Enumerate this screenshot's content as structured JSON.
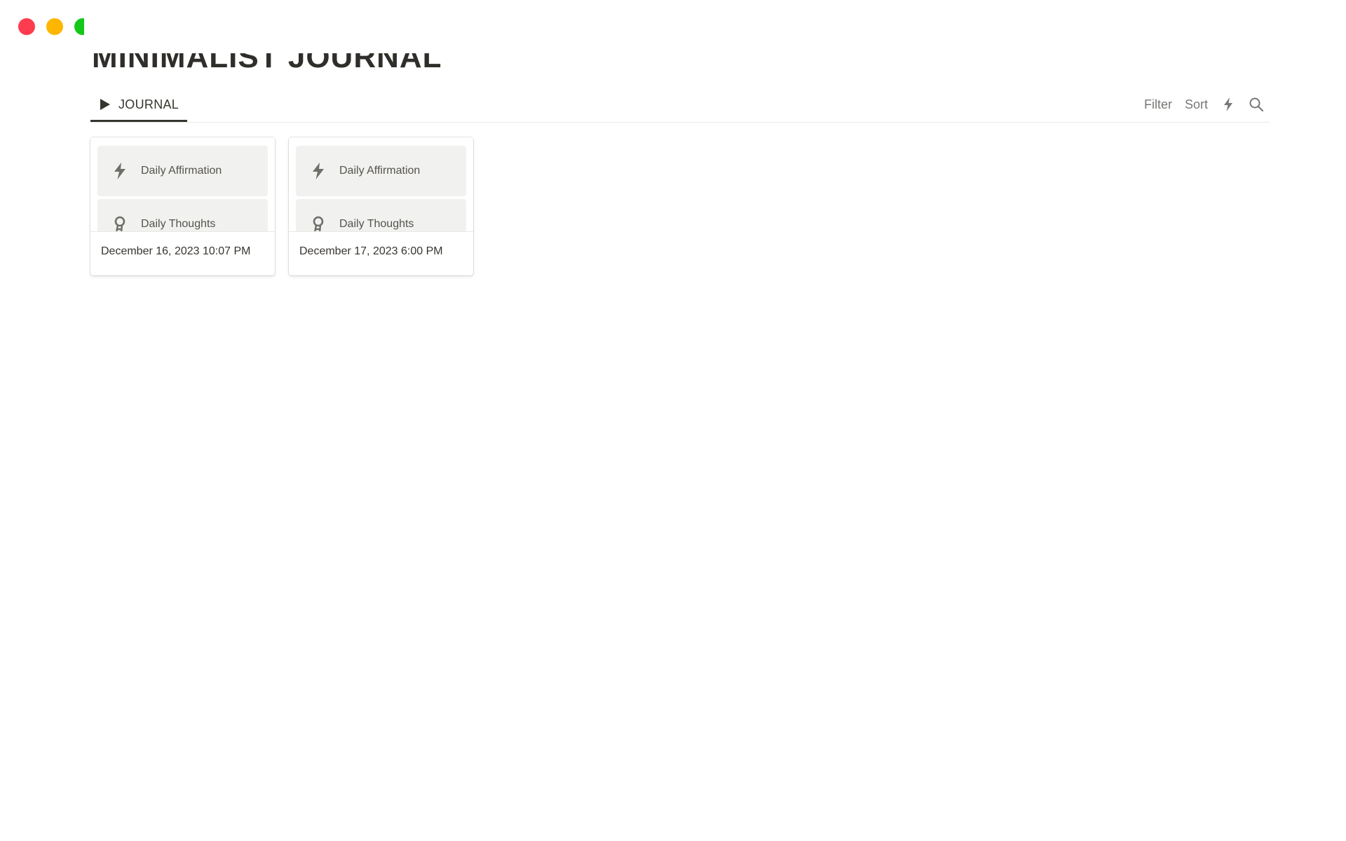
{
  "window": {
    "controls": [
      "close",
      "minimize",
      "maximize"
    ],
    "colors": {
      "close": "#fe3b4f",
      "minimize": "#ffb600",
      "maximize": "#14c819"
    }
  },
  "page": {
    "title": "MINIMALIST JOURNAL"
  },
  "view": {
    "tab_label": "JOURNAL",
    "tab_icon": "play-icon",
    "toolbar": {
      "filter_label": "Filter",
      "sort_label": "Sort",
      "automation_icon": "lightning-icon",
      "search_icon": "search-icon"
    }
  },
  "cards": [
    {
      "blocks": [
        {
          "icon": "lightning-icon",
          "label": "Daily Affirmation"
        },
        {
          "icon": "idea-icon",
          "label": "Daily Thoughts"
        }
      ],
      "date": "December 16, 2023 10:07 PM"
    },
    {
      "blocks": [
        {
          "icon": "lightning-icon",
          "label": "Daily Affirmation"
        },
        {
          "icon": "idea-icon",
          "label": "Daily Thoughts"
        }
      ],
      "date": "December 17, 2023 6:00 PM"
    }
  ],
  "colors": {
    "text": "#37352f",
    "muted": "#787774",
    "block_bg": "#f1f1ef",
    "border": "#e9e9e7"
  }
}
